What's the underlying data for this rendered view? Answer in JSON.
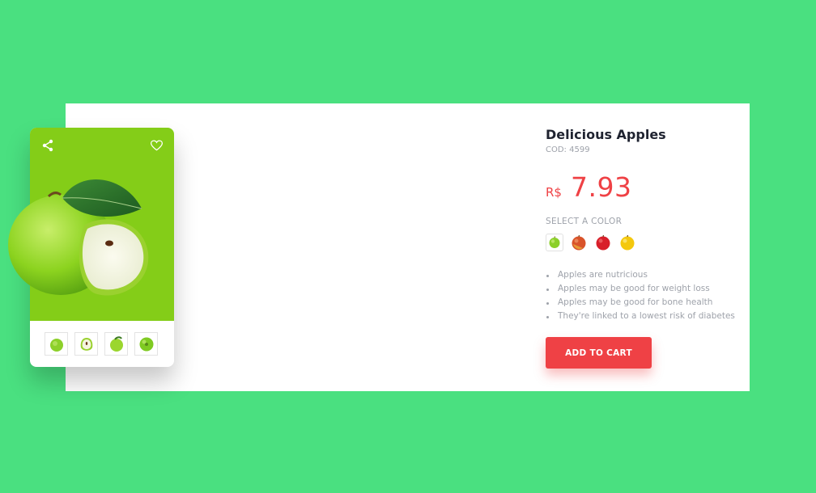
{
  "colors": {
    "background": "#4ae080",
    "card_image_bg": "#84cd18",
    "accent": "#ef4145",
    "title": "#1f2330",
    "muted": "#9ea2aa"
  },
  "card": {
    "share_icon": "share-icon",
    "heart_icon": "heart-icon",
    "hero_image": "green-apple-with-slice",
    "thumbnails": [
      {
        "icon": "green-apple-thumb"
      },
      {
        "icon": "apple-slice-thumb"
      },
      {
        "icon": "green-apple-side-thumb"
      },
      {
        "icon": "green-apple-top-thumb"
      }
    ]
  },
  "product": {
    "title": "Delicious Apples",
    "code": "COD: 4599",
    "currency": "R$",
    "price": "7.93",
    "select_color_label": "SELECT A COLOR",
    "colors": [
      {
        "name": "green",
        "hex": "#8ccf2a"
      },
      {
        "name": "red-yellow",
        "hex": "#d9532a"
      },
      {
        "name": "red",
        "hex": "#d81f2a"
      },
      {
        "name": "yellow",
        "hex": "#f4c80d"
      }
    ],
    "selected_color": "green",
    "features": [
      "Apples are nutricious",
      "Apples may be good for weight loss",
      "Apples may be good for bone health",
      "They're linked to a lowest risk of diabetes"
    ],
    "add_to_cart_label": "ADD TO CART"
  }
}
